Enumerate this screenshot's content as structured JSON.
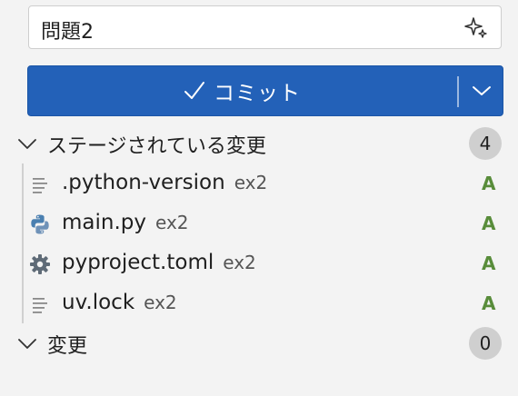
{
  "commit_message": {
    "value": "問題2",
    "sparkle_icon": "sparkle-icon"
  },
  "commit_button": {
    "label": "コミット",
    "check_icon": "check-icon",
    "dropdown_icon": "chevron-down-icon",
    "color": "#2361b8"
  },
  "staged": {
    "title": "ステージされている変更",
    "count": "4",
    "files": [
      {
        "name": ".python-version",
        "dir": "ex2",
        "status": "A",
        "icon": "text-file-icon"
      },
      {
        "name": "main.py",
        "dir": "ex2",
        "status": "A",
        "icon": "python-icon"
      },
      {
        "name": "pyproject.toml",
        "dir": "ex2",
        "status": "A",
        "icon": "gear-icon"
      },
      {
        "name": "uv.lock",
        "dir": "ex2",
        "status": "A",
        "icon": "text-file-icon"
      }
    ]
  },
  "changes": {
    "title": "変更",
    "count": "0"
  },
  "colors": {
    "added_status": "#588c3a",
    "badge_bg": "#cfcfcf",
    "panel_bg": "#f3f3f3"
  }
}
